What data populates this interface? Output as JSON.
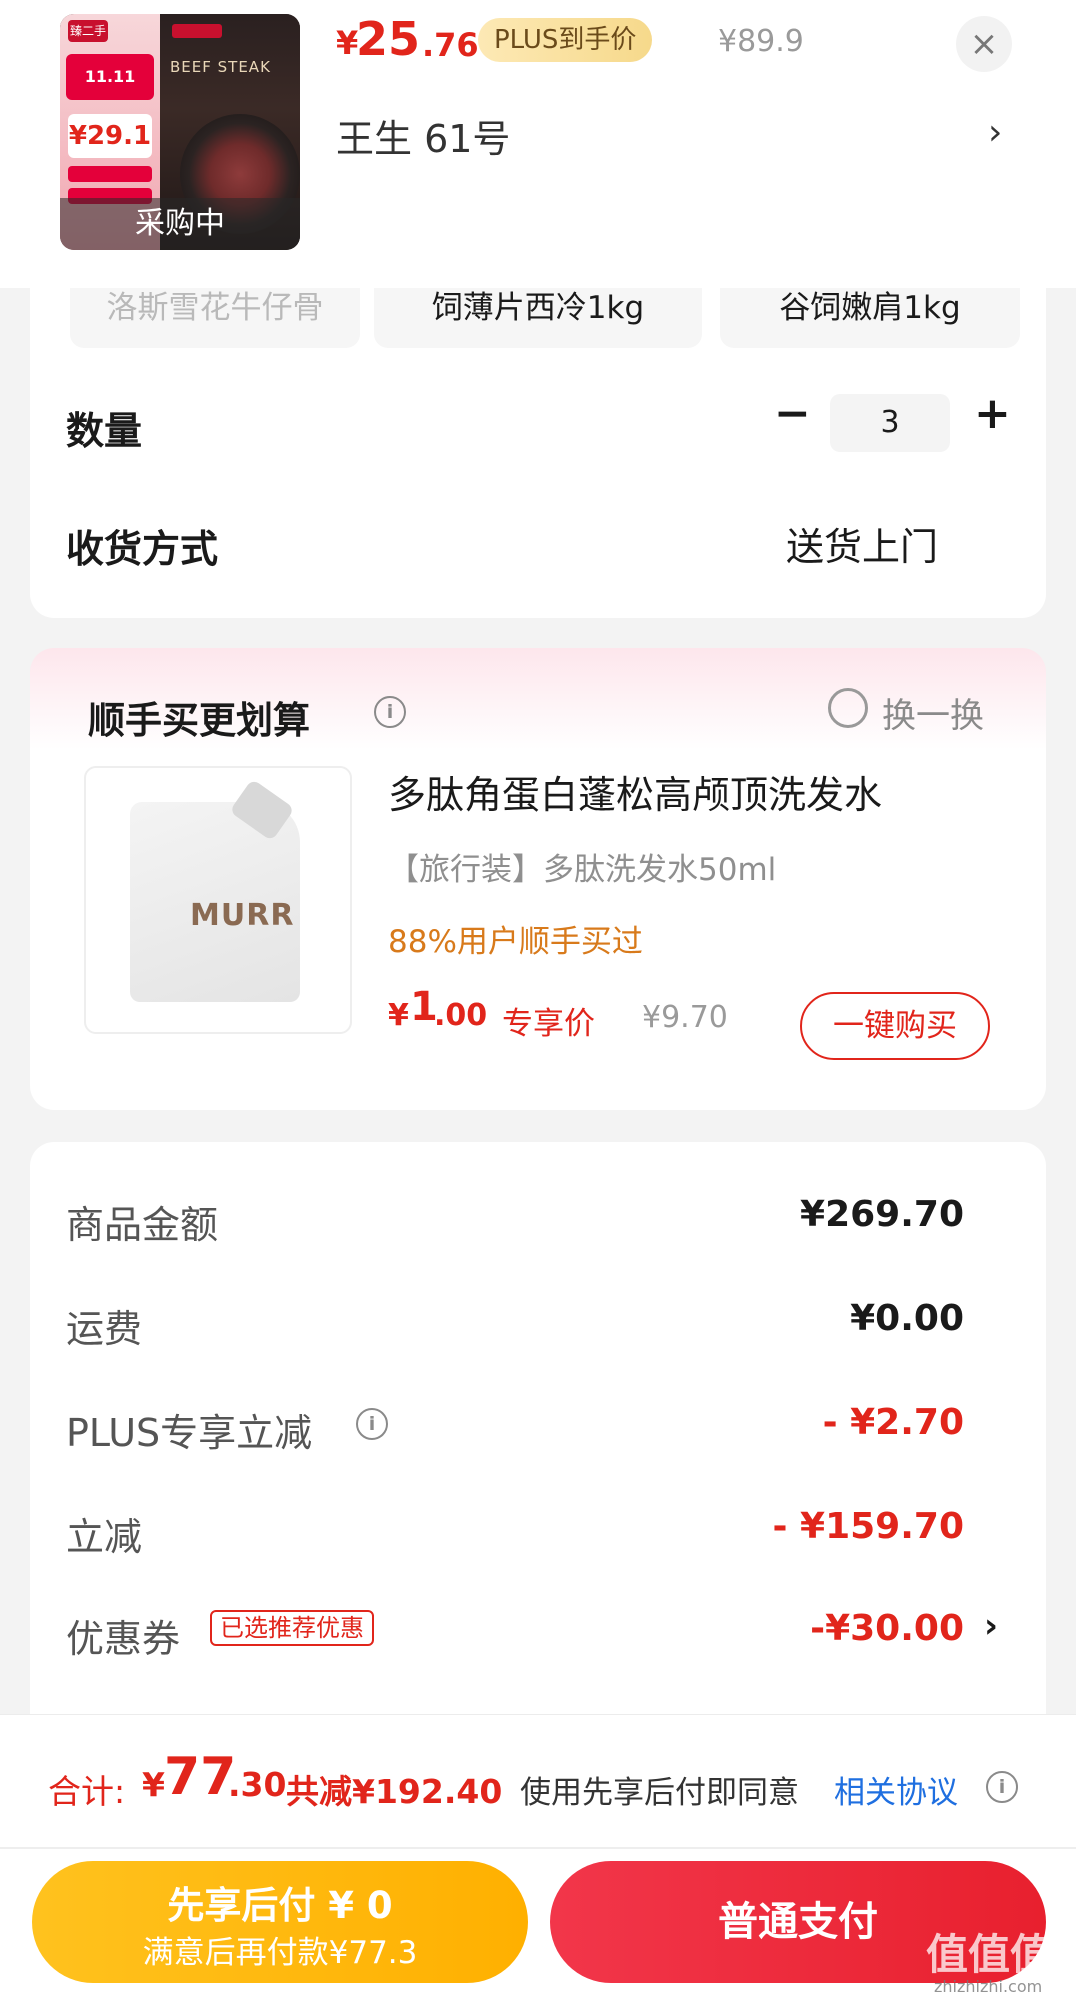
{
  "header": {
    "price_symbol": "¥",
    "price_integer": "25",
    "price_decimal": ".76",
    "plus_badge": "PLUS到手价",
    "original_price": "¥89.9",
    "close_symbol": "×",
    "address": "王生 61号",
    "thumb_overlay": "采购中",
    "thumb_tag": "臻二手",
    "thumb_event": "11.11",
    "thumb_price": "¥29.1",
    "thumb_brand": "BEEF STEAK"
  },
  "options": {
    "chips": [
      "洛斯雪花牛仔骨",
      "饲薄片西冷1kg",
      "谷饲嫩肩1kg"
    ],
    "quantity_label": "数量",
    "quantity_value": "3",
    "minus": "−",
    "plus": "+",
    "delivery_label": "收货方式",
    "delivery_value": "送货上门"
  },
  "recommend": {
    "title": "顺手买更划算",
    "info": "i",
    "swap_label": "换一换",
    "product_name": "多肽角蛋白蓬松高颅顶洗发水",
    "product_spec": "【旅行装】多肽洗发水50ml",
    "buyers": "88%用户顺手买过",
    "price_symbol": "¥",
    "price_integer": "1",
    "price_decimal": ".00",
    "price_tag": "专享价",
    "original_price": "¥9.70",
    "buy_button": "一键购买",
    "image_brand": "MURR"
  },
  "summary": {
    "rows": [
      {
        "label": "商品金额",
        "value": "¥269.70"
      },
      {
        "label": "运费",
        "value": "¥0.00"
      },
      {
        "label": "PLUS专享立减",
        "value": "- ¥2.70"
      },
      {
        "label": "立减",
        "value": "- ¥159.70"
      },
      {
        "label": "优惠券",
        "value": "-¥30.00"
      }
    ],
    "coupon_tag": "已选推荐优惠",
    "chevron": "›",
    "info": "i"
  },
  "bottom": {
    "total_label": "合计:",
    "total_symbol": "¥",
    "total_integer": "77",
    "total_decimal": ".30",
    "total_saved": "共减¥192.40",
    "agree_text": "使用先享后付即同意",
    "agree_link": "相关协议",
    "info": "i",
    "pay_later_title": "先享后付 ¥ 0",
    "pay_later_sub": "满意后再付款¥77.3",
    "pay_normal": "普通支付",
    "watermark": "值值值",
    "watermark_sub": "zhizhizhi.com"
  },
  "colors": {
    "accent_red": "#e1251b",
    "plus_gold": "#f6d98b",
    "pay_later_yellow": "#ffb000",
    "link_blue": "#1f6fe0",
    "buyers_orange": "#d87a1b"
  }
}
